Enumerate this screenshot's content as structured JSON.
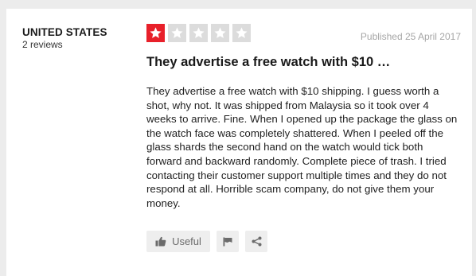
{
  "reviewer": {
    "name": "UNITED STATES",
    "review_count": "2 reviews"
  },
  "rating": {
    "stars": 1,
    "max_stars": 5,
    "filled_color": "#e8202a",
    "empty_color": "#dcdcdc"
  },
  "review": {
    "published": "Published 25 April 2017",
    "title": "They advertise a free watch with $10 …",
    "body": "They advertise a free watch with $10 shipping. I guess worth a shot, why not. It was shipped from Malaysia so it took over 4 weeks to arrive. Fine. When I opened up the package the glass on the watch face was completely shattered. When I peeled off the glass shards the second hand on the watch would tick both forward and backward randomly. Complete piece of trash. I tried contacting their customer support multiple times and they do not respond at all. Horrible scam company, do not give them your money."
  },
  "actions": {
    "useful_label": "Useful",
    "useful_icon": "thumbs-up-icon",
    "flag_icon": "flag-icon",
    "share_icon": "share-icon"
  }
}
